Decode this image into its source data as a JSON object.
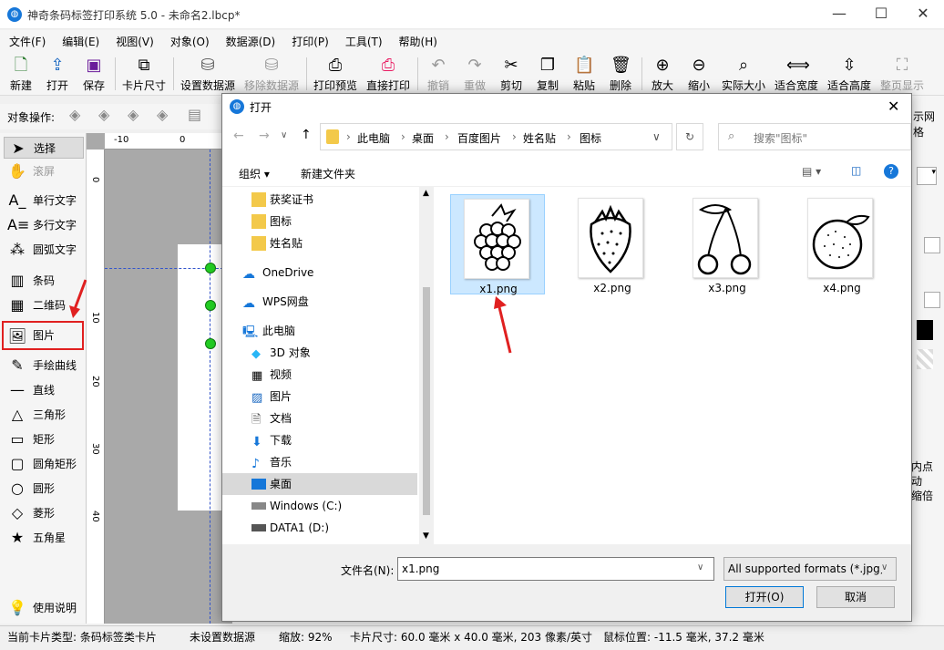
{
  "window": {
    "title": "神奇条码标签打印系统 5.0 - 未命名2.lbcp*"
  },
  "menu": [
    "文件(F)",
    "编辑(E)",
    "视图(V)",
    "对象(O)",
    "数据源(D)",
    "打印(P)",
    "工具(T)",
    "帮助(H)"
  ],
  "toolbar": [
    {
      "label": "新建",
      "icon": "new-file-icon"
    },
    {
      "label": "打开",
      "icon": "open-icon"
    },
    {
      "label": "保存",
      "icon": "save-icon"
    },
    {
      "label": "卡片尺寸",
      "icon": "card-size-icon"
    },
    {
      "label": "设置数据源",
      "icon": "database-icon"
    },
    {
      "label": "移除数据源",
      "icon": "remove-database-icon"
    },
    {
      "label": "打印预览",
      "icon": "print-preview-icon"
    },
    {
      "label": "直接打印",
      "icon": "printer-icon"
    },
    {
      "label": "撤销",
      "icon": "undo-icon"
    },
    {
      "label": "重做",
      "icon": "redo-icon"
    },
    {
      "label": "剪切",
      "icon": "scissors-icon"
    },
    {
      "label": "复制",
      "icon": "copy-icon"
    },
    {
      "label": "粘贴",
      "icon": "paste-icon"
    },
    {
      "label": "删除",
      "icon": "trash-icon"
    },
    {
      "label": "放大",
      "icon": "zoom-in-icon"
    },
    {
      "label": "缩小",
      "icon": "zoom-out-icon"
    },
    {
      "label": "实际大小",
      "icon": "actual-size-icon"
    },
    {
      "label": "适合宽度",
      "icon": "fit-width-icon"
    },
    {
      "label": "适合高度",
      "icon": "fit-height-icon"
    },
    {
      "label": "整页显示",
      "icon": "full-page-icon"
    }
  ],
  "object_ops_label": "对象操作:",
  "right_panel": {
    "grid_label": "示网格",
    "text_lines": [
      "内点",
      "动",
      "缩倍"
    ]
  },
  "left_tools": [
    {
      "label": "选择",
      "icon": "cursor-icon"
    },
    {
      "label": "滚屏",
      "icon": "hand-icon"
    },
    {
      "label": "单行文字",
      "icon": "single-line-text-icon"
    },
    {
      "label": "多行文字",
      "icon": "multi-line-text-icon"
    },
    {
      "label": "圆弧文字",
      "icon": "arc-text-icon"
    },
    {
      "label": "条码",
      "icon": "barcode-icon"
    },
    {
      "label": "二维码",
      "icon": "qrcode-icon"
    },
    {
      "label": "图片",
      "icon": "image-icon"
    },
    {
      "label": "手绘曲线",
      "icon": "pen-icon"
    },
    {
      "label": "直线",
      "icon": "line-icon"
    },
    {
      "label": "三角形",
      "icon": "triangle-icon"
    },
    {
      "label": "矩形",
      "icon": "rectangle-icon"
    },
    {
      "label": "圆角矩形",
      "icon": "rounded-rectangle-icon"
    },
    {
      "label": "圆形",
      "icon": "circle-icon"
    },
    {
      "label": "菱形",
      "icon": "diamond-icon"
    },
    {
      "label": "五角星",
      "icon": "star-icon"
    },
    {
      "label": "使用说明",
      "icon": "lightbulb-icon"
    }
  ],
  "ruler": {
    "h": [
      "-10",
      "0"
    ],
    "v": [
      "0",
      "10",
      "20",
      "30",
      "40"
    ]
  },
  "statusbar": {
    "card_type": "当前卡片类型: 条码标签类卡片",
    "datasource": "未设置数据源",
    "zoom": "缩放: 92%",
    "card_size": "卡片尺寸: 60.0 毫米 x 40.0 毫米, 203 像素/英寸",
    "mouse": "鼠标位置: -11.5 毫米, 37.2 毫米"
  },
  "dialog": {
    "title": "打开",
    "breadcrumb": [
      "此电脑",
      "桌面",
      "百度图片",
      "姓名贴",
      "图标"
    ],
    "search_placeholder": "搜索\"图标\"",
    "organize": "组织",
    "new_folder": "新建文件夹",
    "nav": [
      {
        "label": "获奖证书",
        "icon": "folder-icon"
      },
      {
        "label": "图标",
        "icon": "folder-icon"
      },
      {
        "label": "姓名贴",
        "icon": "folder-icon"
      },
      {
        "label": "OneDrive",
        "icon": "cloud-icon"
      },
      {
        "label": "WPS网盘",
        "icon": "cloud-drive-icon"
      },
      {
        "label": "此电脑",
        "icon": "computer-icon"
      },
      {
        "label": "3D 对象",
        "icon": "cube-icon"
      },
      {
        "label": "视频",
        "icon": "video-icon"
      },
      {
        "label": "图片",
        "icon": "pictures-icon"
      },
      {
        "label": "文档",
        "icon": "document-icon"
      },
      {
        "label": "下载",
        "icon": "download-icon"
      },
      {
        "label": "音乐",
        "icon": "music-icon"
      },
      {
        "label": "桌面",
        "icon": "desktop-icon"
      },
      {
        "label": "Windows (C:)",
        "icon": "drive-icon"
      },
      {
        "label": "DATA1 (D:)",
        "icon": "drive-icon"
      }
    ],
    "files": [
      {
        "name": "x1.png",
        "icon": "raspberry-icon"
      },
      {
        "name": "x2.png",
        "icon": "strawberry-icon"
      },
      {
        "name": "x3.png",
        "icon": "cherry-icon"
      },
      {
        "name": "x4.png",
        "icon": "orange-icon"
      }
    ],
    "filename_label": "文件名(N):",
    "filename_value": "x1.png",
    "filetype": "All supported formats (*.jpg;",
    "open_btn": "打开(O)",
    "cancel_btn": "取消"
  },
  "colors": {
    "accent": "#cce8ff",
    "annotation": "#e02020",
    "handle": "#22cc22"
  }
}
